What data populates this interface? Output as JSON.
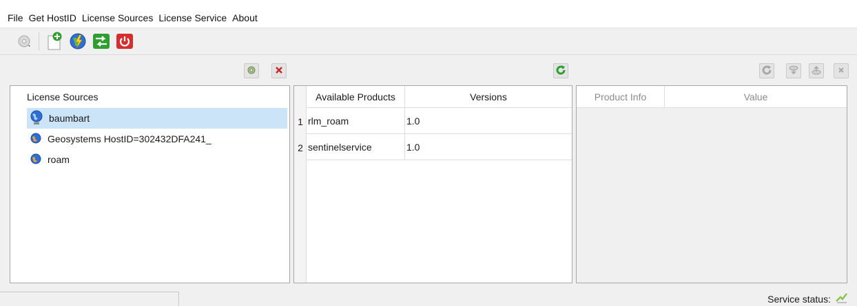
{
  "menu": {
    "items": [
      "File",
      "Get HostID",
      "License Sources",
      "License Service",
      "About"
    ]
  },
  "toolbar": {
    "icons": [
      "disc-dropdown-icon",
      "add-document-icon",
      "globe-lightning-icon",
      "exchange-arrows-icon",
      "power-icon"
    ]
  },
  "sources_panel": {
    "header": "License Sources",
    "items": [
      {
        "label": "baumbart",
        "selected": true
      },
      {
        "label": "Geosystems  HostID=302432DFA241_",
        "selected": false
      },
      {
        "label": "roam",
        "selected": false
      }
    ]
  },
  "products_panel": {
    "columns": [
      "Available Products",
      "Versions"
    ],
    "rows": [
      {
        "num": "1",
        "product": "rlm_roam",
        "version": "1.0"
      },
      {
        "num": "2",
        "product": "sentinelservice",
        "version": "1.0"
      }
    ]
  },
  "info_panel": {
    "columns": [
      "Product Info",
      "Value"
    ]
  },
  "status": {
    "label": "Service status:"
  },
  "colors": {
    "selection": "#cce4f7",
    "refresh_green": "#2e9e2e",
    "delete_red": "#c62828",
    "power_red": "#d32f2f"
  }
}
